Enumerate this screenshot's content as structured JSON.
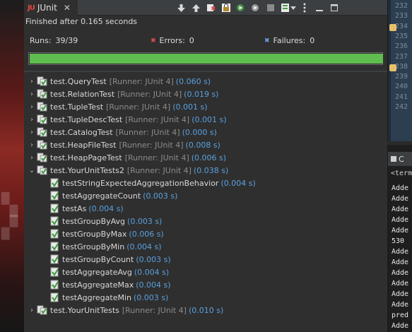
{
  "tab": {
    "title": "JUnit",
    "close": "✕"
  },
  "status": {
    "finished": "Finished after 0.165 seconds"
  },
  "stats": {
    "runs_label": "Runs:",
    "runs_value": "39/39",
    "errors_label": "Errors:",
    "errors_value": "0",
    "failures_label": "Failures:",
    "failures_value": "0",
    "progress": 1.0
  },
  "toolbar": {
    "buttons": [
      {
        "name": "next-failure-icon"
      },
      {
        "name": "previous-failure-icon"
      },
      {
        "name": "show-failures-only-icon"
      },
      {
        "name": "scroll-lock-icon"
      },
      {
        "name": "rerun-icon"
      },
      {
        "name": "rerun-failed-icon"
      },
      {
        "name": "stop-icon"
      },
      {
        "name": "test-history-icon"
      },
      {
        "name": "history-dropdown-icon"
      },
      {
        "name": "view-menu-icon"
      },
      {
        "name": "minimize-icon"
      },
      {
        "name": "maximize-icon"
      }
    ]
  },
  "colors": {
    "pass": "#5ebd4e",
    "time": "#5aa0de",
    "runner": "#8c8c8c"
  },
  "tree": [
    {
      "name": "test.QueryTest",
      "runner": "[Runner: JUnit 4]",
      "time": "(0.060 s)",
      "expanded": false
    },
    {
      "name": "test.RelationTest",
      "runner": "[Runner: JUnit 4]",
      "time": "(0.019 s)",
      "expanded": false
    },
    {
      "name": "test.TupleTest",
      "runner": "[Runner: JUnit 4]",
      "time": "(0.001 s)",
      "expanded": false
    },
    {
      "name": "test.TupleDescTest",
      "runner": "[Runner: JUnit 4]",
      "time": "(0.001 s)",
      "expanded": false
    },
    {
      "name": "test.CatalogTest",
      "runner": "[Runner: JUnit 4]",
      "time": "(0.000 s)",
      "expanded": false
    },
    {
      "name": "test.HeapFileTest",
      "runner": "[Runner: JUnit 4]",
      "time": "(0.008 s)",
      "expanded": false
    },
    {
      "name": "test.HeapPageTest",
      "runner": "[Runner: JUnit 4]",
      "time": "(0.006 s)",
      "expanded": false
    },
    {
      "name": "test.YourUnitTests2",
      "runner": "[Runner: JUnit 4]",
      "time": "(0.038 s)",
      "expanded": true,
      "children": [
        {
          "name": "testStringExpectedAggregationBehavior",
          "time": "(0.004 s)"
        },
        {
          "name": "testAggregateCount",
          "time": "(0.003 s)"
        },
        {
          "name": "testAs",
          "time": "(0.004 s)"
        },
        {
          "name": "testGroupByAvg",
          "time": "(0.003 s)"
        },
        {
          "name": "testGroupByMax",
          "time": "(0.006 s)"
        },
        {
          "name": "testGroupByMin",
          "time": "(0.004 s)"
        },
        {
          "name": "testGroupByCount",
          "time": "(0.003 s)"
        },
        {
          "name": "testAggregateAvg",
          "time": "(0.004 s)"
        },
        {
          "name": "testAggregateMax",
          "time": "(0.004 s)"
        },
        {
          "name": "testAggregateMin",
          "time": "(0.003 s)"
        }
      ]
    },
    {
      "name": "test.YourUnitTests",
      "runner": "[Runner: JUnit 4]",
      "time": "(0.010 s)",
      "expanded": false
    }
  ],
  "editor": {
    "line_numbers": [
      "232",
      "233",
      "234",
      "235",
      "236",
      "237",
      "238",
      "239",
      "240",
      "241",
      "242"
    ],
    "breakpoints": [
      "234",
      "238"
    ]
  },
  "console": {
    "tab_label": "C",
    "path": "<term",
    "lines": [
      "Adde",
      "Adde",
      "Adde",
      "Adde",
      "Adde",
      "530",
      "Adde",
      "Adde",
      "Adde",
      "Adde",
      "Adde",
      "Adde",
      "pred",
      "Adde"
    ]
  }
}
